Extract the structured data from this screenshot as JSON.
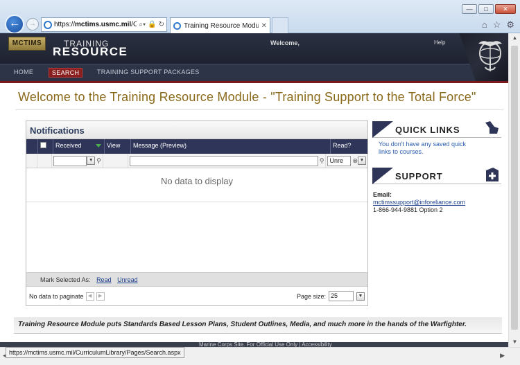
{
  "browser": {
    "url": "https://mctims.usmc.mil/C",
    "url_host": "mctims.usmc.mil",
    "tab_title": "Training Resource Module ...",
    "status_url": "https://mctims.usmc.mil/CurriculumLibrary/Pages/Search.aspx"
  },
  "site": {
    "logo": "MCTIMS",
    "brand_top": "TRAINING",
    "brand_bottom": "RESOURCE",
    "welcome": "Welcome,",
    "help": "Help"
  },
  "nav": [
    {
      "label": "HOME"
    },
    {
      "label": "SEARCH"
    },
    {
      "label": "TRAINING SUPPORT PACKAGES"
    }
  ],
  "headline": "Welcome to the Training Resource Module - \"Training Support to the Total Force\"",
  "notifications": {
    "title": "Notifications",
    "columns": [
      "Received",
      "View",
      "Message (Preview)",
      "Read?"
    ],
    "read_filter": "Unre",
    "empty": "No data to display",
    "mark_label": "Mark Selected As:",
    "mark_read": "Read",
    "mark_unread": "Unread",
    "paginate": "No data to paginate",
    "page_size_label": "Page size:",
    "page_size": "25"
  },
  "quick_links": {
    "title": "QUICK LINKS",
    "text": "You don't have any saved quick links to courses."
  },
  "support": {
    "title": "SUPPORT",
    "email_label": "Email:",
    "email": "mctimssupport@inforeliance.com",
    "phone": "1-866-944-9881 Option 2"
  },
  "tagline": "Training Resource Module puts Standards Based Lesson Plans, Student Outlines, Media, and much more in the hands of the Warfighter.",
  "footer": "Marine Corps Site. For Official Use Only | Accessibility",
  "colors": {
    "header": "#2b3142",
    "nav_active": "#8b1e1e",
    "headline": "#8a6a1a",
    "grid_header": "#2f3558"
  }
}
